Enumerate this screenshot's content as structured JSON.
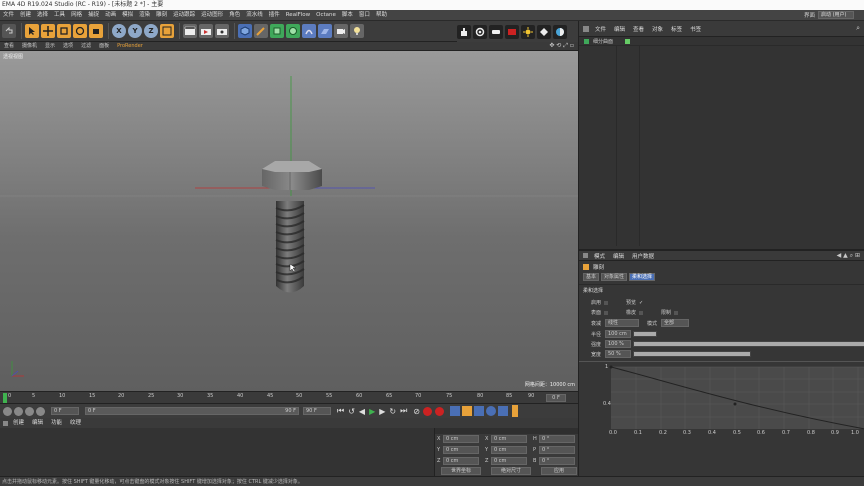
{
  "app": {
    "title": "EMA 4D R19.024 Studio (RC - R19) - [未标题 2 *] - 主要"
  },
  "menubar": {
    "items": [
      "文件",
      "创建",
      "选择",
      "工具",
      "网格",
      "捕捉",
      "动画",
      "模拟",
      "渲染",
      "雕刻",
      "运动跟踪",
      "运动图形",
      "角色",
      "流水线",
      "插件",
      "RealFlow",
      "Octane",
      "脚本",
      "窗口",
      "帮助"
    ],
    "layout_label": "界面",
    "layout_value": "启动 (用户)"
  },
  "viewport_menu": {
    "items": [
      "查看",
      "摄像机",
      "显示",
      "选项",
      "过滤",
      "面板",
      "ProRender"
    ]
  },
  "viewport": {
    "label": "透视视图",
    "grid_spacing": "网格间距：10000 cm"
  },
  "timeline": {
    "ticks": [
      "0",
      "5",
      "10",
      "15",
      "20",
      "25",
      "30",
      "35",
      "40",
      "45",
      "50",
      "55",
      "60",
      "65",
      "70",
      "75",
      "80",
      "85",
      "90"
    ],
    "end_frame": "0 F"
  },
  "playbar": {
    "current_frame": "0 F",
    "start_frame": "0 F",
    "range_end": "90 F",
    "end_frame": "90 F"
  },
  "bottom_tabs": {
    "items": [
      "创建",
      "编辑",
      "功能",
      "纹理"
    ]
  },
  "coordinates": {
    "rows": [
      {
        "a": "X",
        "a_val": "0 cm",
        "b": "X",
        "b_val": "0 cm",
        "c": "H",
        "c_val": "0 °"
      },
      {
        "a": "Y",
        "a_val": "0 cm",
        "b": "Y",
        "b_val": "0 cm",
        "c": "P",
        "c_val": "0 °"
      },
      {
        "a": "Z",
        "a_val": "0 cm",
        "b": "Z",
        "b_val": "0 cm",
        "c": "B",
        "c_val": "0 °"
      }
    ],
    "mode_left": "世界坐标",
    "mode_mid": "绝对尺寸",
    "apply": "应用"
  },
  "object_manager": {
    "tabs": [
      "文件",
      "编辑",
      "查看",
      "对象",
      "标签",
      "书签"
    ],
    "object_name": "细分曲面"
  },
  "attributes": {
    "menu": [
      "模式",
      "编辑",
      "用户数据"
    ],
    "object_title": "雕刻",
    "subtabs": [
      "基本",
      "对象属性",
      "柔和选择"
    ],
    "section": "柔和选择",
    "rows": {
      "enable": "启用",
      "preview": "预览",
      "surface": "表面",
      "rubber": "橡皮",
      "limit": "限制",
      "falloff": "衰减",
      "falloff_value": "线性",
      "mode": "模式",
      "mode_value": "全部",
      "radius": "半径",
      "radius_value": "100 cm",
      "strength": "强度",
      "strength_value": "100 %",
      "width": "宽度",
      "width_value": "50 %"
    },
    "curve": {
      "y_labels": [
        "1",
        "0.8",
        "0.6",
        "0.4",
        "0.2"
      ],
      "x_labels": [
        "0.0",
        "0.1",
        "0.2",
        "0.3",
        "0.4",
        "0.5",
        "0.6",
        "0.7",
        "0.8",
        "0.9",
        "1.0"
      ]
    }
  },
  "status": {
    "text": "点击并拖动鼠标移动元素。按住 SHIFT 键量化移动，可点击键盘的模式对象按住 SHIFT 键增加选择对象；按住 CTRL 键减少选择对象。"
  },
  "colors": {
    "accent": "#e8a23a",
    "axis_x": "#c03030",
    "axis_y": "#3a9a3a",
    "axis_z": "#3a3ac0",
    "timeline_marker": "#3fb34f"
  }
}
